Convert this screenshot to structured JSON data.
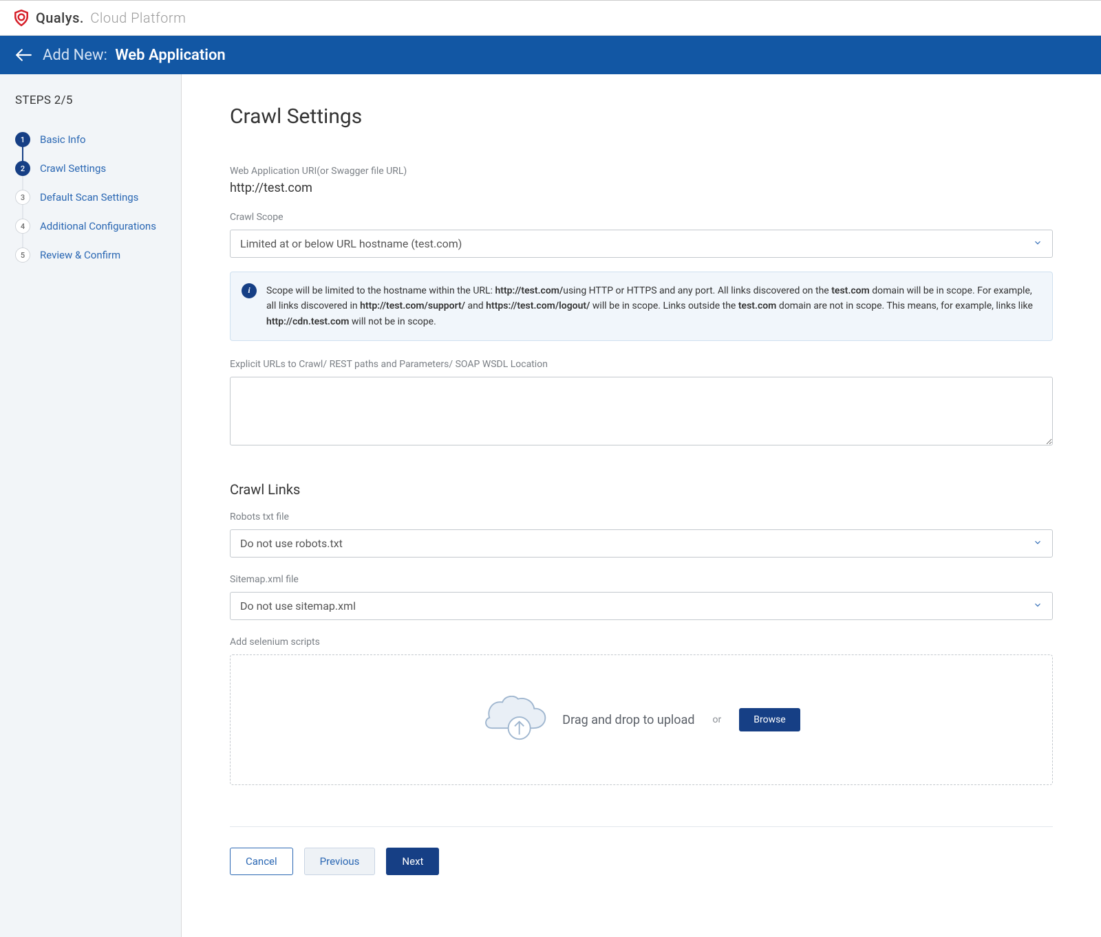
{
  "brand": {
    "name": "Qualys.",
    "suffix": "Cloud Platform"
  },
  "header": {
    "prefix": "Add New:",
    "title": "Web Application"
  },
  "sidebar": {
    "steps_label": "STEPS 2/5",
    "items": [
      {
        "num": "1",
        "label": "Basic Info",
        "state": "done"
      },
      {
        "num": "2",
        "label": "Crawl Settings",
        "state": "active"
      },
      {
        "num": "3",
        "label": "Default Scan Settings",
        "state": "pending"
      },
      {
        "num": "4",
        "label": "Additional Configurations",
        "state": "pending"
      },
      {
        "num": "5",
        "label": "Review & Confirm",
        "state": "pending"
      }
    ]
  },
  "main": {
    "page_title": "Crawl Settings",
    "uri_label": "Web Application URI(or Swagger file URL)",
    "uri_value": "http://test.com",
    "crawl_scope_label": "Crawl Scope",
    "crawl_scope_value": "Limited at or below URL hostname (test.com)",
    "info": {
      "parts": [
        "Scope will be limited to the hostname within the URL: ",
        "http://test.com/",
        "using HTTP or HTTPS and any port. All links discovered on the ",
        "test.com",
        " domain will be in scope. For example, all links discovered in ",
        "http://test.com/support/",
        " and ",
        "https://test.com/logout/",
        " will be in scope. Links outside the ",
        "test.com",
        " domain are not in scope. This means, for example, links like ",
        "http://cdn.test.com",
        " will not be in scope."
      ]
    },
    "explicit_urls_label": "Explicit URLs to Crawl/ REST paths and Parameters/ SOAP WSDL Location",
    "explicit_urls_value": "",
    "crawl_links_title": "Crawl Links",
    "robots_label": "Robots txt file",
    "robots_value": "Do not use robots.txt",
    "sitemap_label": "Sitemap.xml file",
    "sitemap_value": "Do not use sitemap.xml",
    "selenium_label": "Add selenium scripts",
    "upload_text": "Drag and drop to upload",
    "upload_or": "or",
    "browse_label": "Browse"
  },
  "footer": {
    "cancel": "Cancel",
    "previous": "Previous",
    "next": "Next"
  }
}
